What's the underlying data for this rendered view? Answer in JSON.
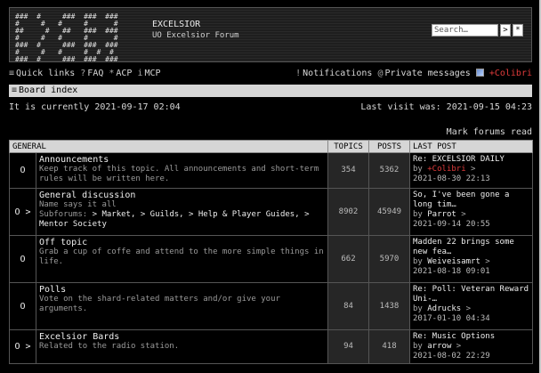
{
  "header": {
    "logo_art": "###  #     ###  ###  ###\n#     #   #     #      #\n##     #   ##   ###  ###\n#     #   #     #      #\n###  #     ###  ###  ###\n#     #   #     #  #  #\n###  #     ###  ###  ###",
    "site_title": "EXCELSIOR",
    "site_desc": "UO Excelsior Forum",
    "search_placeholder": "Search…",
    "search_button": ">",
    "advanced_button": "*"
  },
  "navbar": {
    "quick_links": "Quick links",
    "faq": "FAQ",
    "acp": "ACP",
    "mcp": "MCP",
    "notifications": "Notifications",
    "private_messages": "Private messages",
    "username": "+Colibri"
  },
  "breadcrumb": {
    "board_index": "Board index"
  },
  "time": {
    "current": "It is currently 2021-09-17 02:04",
    "last_visit": "Last visit was: 2021-09-15 04:23"
  },
  "mark_read": "Mark forums read",
  "table": {
    "headers": {
      "general": "GENERAL",
      "topics": "TOPICS",
      "posts": "POSTS",
      "last_post": "LAST POST"
    },
    "rows": [
      {
        "icon": "O",
        "title": "Announcements",
        "desc": "Keep track of this topic. All announcements and short-term rules will be written here.",
        "topics": "354",
        "posts": "5362",
        "lp_title": "Re: EXCELSIOR DAILY",
        "lp_user": "+Colibri",
        "lp_date": "2021-08-30 22:13"
      },
      {
        "icon": "O >",
        "title": "General discussion",
        "desc": "Name says it all",
        "subforums_label": "Subforums:",
        "subforums": [
          "Market,",
          "Guilds,",
          "Help & Player Guides,",
          "Mentor Society"
        ],
        "topics": "8902",
        "posts": "45949",
        "lp_title": "So, I've been gone a long tim…",
        "lp_user": "Parrot",
        "lp_date": "2021-09-14 20:55"
      },
      {
        "icon": "O",
        "title": "Off topic",
        "desc": "Grab a cup of coffe and attend to the more simple things in life.",
        "topics": "662",
        "posts": "5970",
        "lp_title": "Madden 22 brings some new fea…",
        "lp_user": "Weiveisamrt",
        "lp_date": "2021-08-18 09:01"
      },
      {
        "icon": "O",
        "title": "Polls",
        "desc": "Vote on the shard-related matters and/or give your arguments.",
        "topics": "84",
        "posts": "1438",
        "lp_title": "Re: Poll: Veteran Reward Uni-…",
        "lp_user": "Adrucks",
        "lp_date": "2017-01-10 04:34"
      },
      {
        "icon": "O >",
        "title": "Excelsior Bards",
        "desc": "Related to the radio station.",
        "topics": "94",
        "posts": "418",
        "lp_title": "Re: Music Options",
        "lp_user": "arrow",
        "lp_date": "2021-08-02 22:29"
      }
    ]
  }
}
